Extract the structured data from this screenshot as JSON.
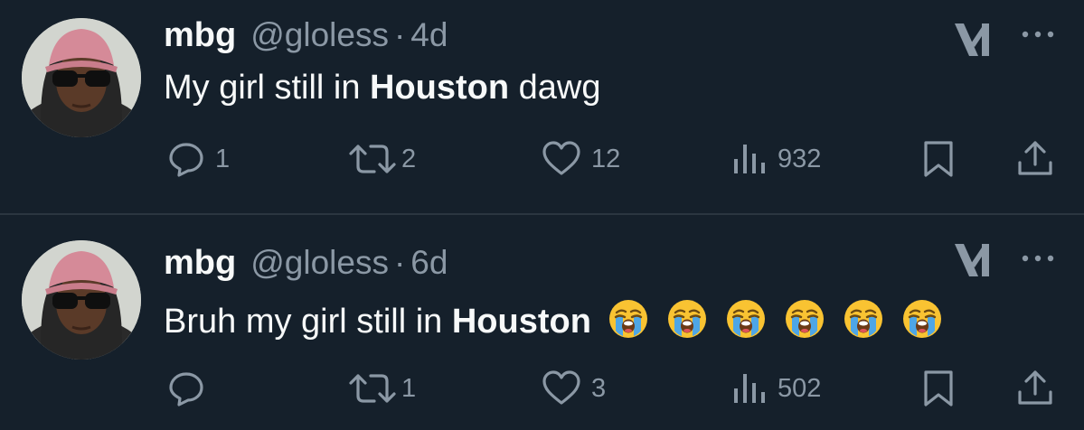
{
  "colors": {
    "background": "#15202b",
    "text_primary": "#f7f9f9",
    "text_secondary": "#8b98a5",
    "divider": "#2b3640"
  },
  "tweets": [
    {
      "author_name": "mbg",
      "handle": "@gloless",
      "separator": "·",
      "time": "4d",
      "text_before": "My girl still in ",
      "text_bold": "Houston",
      "text_after": " dawg",
      "emojis": [],
      "replies": "1",
      "reposts": "2",
      "likes": "12",
      "views": "932",
      "icons": [
        "reply-icon",
        "repost-icon",
        "like-icon",
        "views-icon",
        "bookmark-icon",
        "share-icon",
        "grok-icon",
        "more-icon"
      ]
    },
    {
      "author_name": "mbg",
      "handle": "@gloless",
      "separator": "·",
      "time": "6d",
      "text_before": "Bruh my girl still in ",
      "text_bold": "Houston",
      "text_after": "",
      "emojis": [
        "loudly-crying-face",
        "loudly-crying-face",
        "loudly-crying-face",
        "loudly-crying-face",
        "loudly-crying-face",
        "loudly-crying-face"
      ],
      "replies": "",
      "reposts": "1",
      "likes": "3",
      "views": "502",
      "icons": [
        "reply-icon",
        "repost-icon",
        "like-icon",
        "views-icon",
        "bookmark-icon",
        "share-icon",
        "grok-icon",
        "more-icon"
      ]
    }
  ]
}
